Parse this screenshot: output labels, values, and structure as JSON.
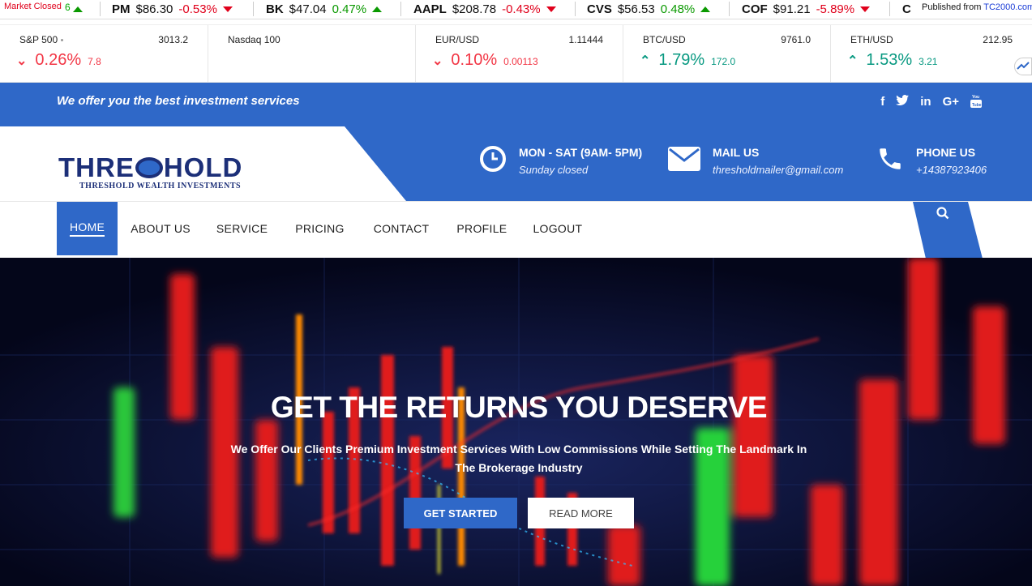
{
  "ticker": {
    "status": "Market Closed",
    "fragment_left": "6",
    "items": [
      {
        "symbol": "PM",
        "price": "$86.30",
        "change": "-0.53%",
        "dir": "down"
      },
      {
        "symbol": "BK",
        "price": "$47.04",
        "change": "0.47%",
        "dir": "up"
      },
      {
        "symbol": "AAPL",
        "price": "$208.78",
        "change": "-0.43%",
        "dir": "down"
      },
      {
        "symbol": "CVS",
        "price": "$56.53",
        "change": "0.48%",
        "dir": "up"
      },
      {
        "symbol": "COF",
        "price": "$91.21",
        "change": "-5.89%",
        "dir": "down"
      },
      {
        "symbol": "C",
        "price": "",
        "change": "",
        "dir": ""
      }
    ],
    "published_prefix": "Published from",
    "published_link": "TC2000.com"
  },
  "markets": [
    {
      "name": "S&P 500",
      "price": "3013.2",
      "percent": "0.26%",
      "abs": "7.8",
      "dir": "down"
    },
    {
      "name": "Nasdaq 100",
      "price": "",
      "percent": "",
      "abs": "",
      "dir": ""
    },
    {
      "name": "EUR/USD",
      "price": "1.11444",
      "percent": "0.10%",
      "abs": "0.00113",
      "dir": "down"
    },
    {
      "name": "BTC/USD",
      "price": "9761.0",
      "percent": "1.79%",
      "abs": "172.0",
      "dir": "up"
    },
    {
      "name": "ETH/USD",
      "price": "212.95",
      "percent": "1.53%",
      "abs": "3.21",
      "dir": "up"
    }
  ],
  "topbar": {
    "tagline": "We offer you the best investment services",
    "socials": [
      "facebook-icon",
      "twitter-icon",
      "linkedin-icon",
      "google-plus-icon",
      "youtube-icon"
    ]
  },
  "header": {
    "logo_pre": "THRE",
    "logo_post": "HOLD",
    "logo_sub": "THRESHOLD WEALTH INVESTMENTS",
    "hours_title": "MON - SAT (9AM- 5PM)",
    "hours_sub": "Sunday closed",
    "mail_title": "MAIL US",
    "mail_sub": "thresholdmailer@gmail.com",
    "phone_title": "PHONE US",
    "phone_sub": "+14387923406"
  },
  "nav": {
    "items": [
      "HOME",
      "ABOUT US",
      "SERVICE",
      "PRICING",
      "CONTACT",
      "PROFILE",
      "LOGOUT"
    ],
    "active": "HOME"
  },
  "hero": {
    "title": "GET THE RETURNS YOU DESERVE",
    "subtitle_line1": "We Offer Our Clients Premium Investment Services With Low Commissions While Setting The Landmark In",
    "subtitle_line2": "The Brokerage Industry",
    "primary_button": "GET STARTED",
    "secondary_button": "READ MORE"
  },
  "colors": {
    "brand_blue": "#2f68c8",
    "logo_navy": "#1c2f78",
    "negative": "#f23645",
    "positive": "#089981",
    "hero_bg": "#050920"
  }
}
